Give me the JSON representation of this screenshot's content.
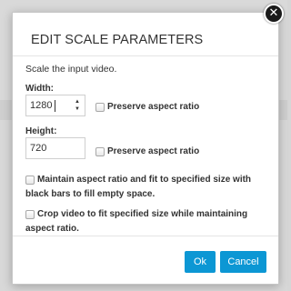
{
  "dialog": {
    "title": "EDIT SCALE PARAMETERS",
    "description": "Scale the input video.",
    "close_glyph": "✕",
    "width": {
      "label": "Width:",
      "value": "1280",
      "preserve_label": "Preserve aspect ratio"
    },
    "height": {
      "label": "Height:",
      "value": "720",
      "preserve_label": "Preserve aspect ratio"
    },
    "options": {
      "fit_black_bars": "Maintain aspect ratio and fit to specified size with black bars to fill empty space.",
      "crop": "Crop video to fit specified size while maintaining aspect ratio."
    },
    "buttons": {
      "ok": "Ok",
      "cancel": "Cancel"
    }
  },
  "icons": {
    "close": "close-icon",
    "spin_up": "chevron-up-icon",
    "spin_down": "chevron-down-icon"
  },
  "colors": {
    "accent": "#0c97d4",
    "overlay": "#d6d6d6"
  }
}
